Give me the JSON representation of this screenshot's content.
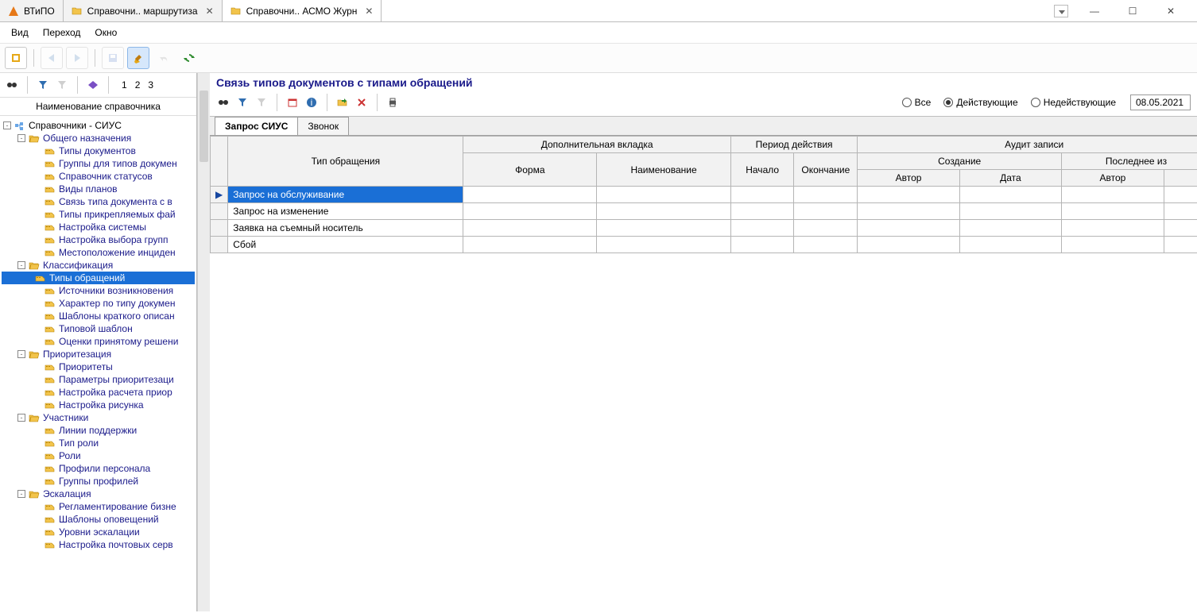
{
  "tabs": [
    {
      "label": "ВТиПО",
      "type": "triangle"
    },
    {
      "label": "Справочни.. маршрутиза",
      "type": "folder",
      "closable": true
    },
    {
      "label": "Справочни.. АСМО Журн",
      "type": "folder",
      "closable": true,
      "active": true
    }
  ],
  "menu": {
    "view": "Вид",
    "nav": "Переход",
    "window": "Окно"
  },
  "pager": {
    "one": "1",
    "two": "2",
    "three": "3"
  },
  "tree_header": "Наименование справочника",
  "tree": [
    {
      "lvl": 0,
      "t": "root",
      "toggle": "-",
      "label": "Справочники - СИУС",
      "black": true
    },
    {
      "lvl": 1,
      "t": "folder",
      "toggle": "-",
      "label": "Общего назначения"
    },
    {
      "lvl": 2,
      "t": "leaf",
      "label": "Типы документов"
    },
    {
      "lvl": 2,
      "t": "leaf",
      "label": "Группы для типов докумен"
    },
    {
      "lvl": 2,
      "t": "leaf",
      "label": "Справочник статусов"
    },
    {
      "lvl": 2,
      "t": "leaf",
      "label": "Виды планов"
    },
    {
      "lvl": 2,
      "t": "leaf",
      "label": "Связь типа документа с в"
    },
    {
      "lvl": 2,
      "t": "leaf",
      "label": "Типы прикрепляемых фай"
    },
    {
      "lvl": 2,
      "t": "leaf",
      "label": "Настройка системы"
    },
    {
      "lvl": 2,
      "t": "leaf",
      "label": "Настройка  выбора групп"
    },
    {
      "lvl": 2,
      "t": "leaf",
      "label": "Местоположение инциден"
    },
    {
      "lvl": 1,
      "t": "folder",
      "toggle": "-",
      "label": "Классификация"
    },
    {
      "lvl": 2,
      "t": "leaf",
      "label": "Типы обращений",
      "selected": true
    },
    {
      "lvl": 2,
      "t": "leaf",
      "label": "Источники возникновения"
    },
    {
      "lvl": 2,
      "t": "leaf",
      "label": "Характер по типу докумен"
    },
    {
      "lvl": 2,
      "t": "leaf",
      "label": "Шаблоны краткого описан"
    },
    {
      "lvl": 2,
      "t": "leaf",
      "label": "Типовой шаблон"
    },
    {
      "lvl": 2,
      "t": "leaf",
      "label": "Оценки принятому решени"
    },
    {
      "lvl": 1,
      "t": "folder",
      "toggle": "-",
      "label": "Приоритезация"
    },
    {
      "lvl": 2,
      "t": "leaf",
      "label": "Приоритеты"
    },
    {
      "lvl": 2,
      "t": "leaf",
      "label": "Параметры приоритезаци"
    },
    {
      "lvl": 2,
      "t": "leaf",
      "label": "Настройка расчета приор"
    },
    {
      "lvl": 2,
      "t": "leaf",
      "label": "Настройка рисунка"
    },
    {
      "lvl": 1,
      "t": "folder",
      "toggle": "-",
      "label": "Участники"
    },
    {
      "lvl": 2,
      "t": "leaf",
      "label": "Линии поддержки"
    },
    {
      "lvl": 2,
      "t": "leaf",
      "label": "Тип роли"
    },
    {
      "lvl": 2,
      "t": "leaf",
      "label": "Роли"
    },
    {
      "lvl": 2,
      "t": "leaf",
      "label": "Профили персонала"
    },
    {
      "lvl": 2,
      "t": "leaf",
      "label": "Группы профилей"
    },
    {
      "lvl": 1,
      "t": "folder",
      "toggle": "-",
      "label": "Эскалация"
    },
    {
      "lvl": 2,
      "t": "leaf",
      "label": "Регламентирование бизне"
    },
    {
      "lvl": 2,
      "t": "leaf",
      "label": "Шаблоны оповещений"
    },
    {
      "lvl": 2,
      "t": "leaf",
      "label": "Уровни эскалации"
    },
    {
      "lvl": 2,
      "t": "leaf",
      "label": "Настройка почтовых серв"
    }
  ],
  "page_title": "Связь типов документов с типами обращений",
  "filter": {
    "all": "Все",
    "active": "Действующие",
    "inactive": "Недействующие",
    "selected": "active",
    "date": "08.05.2021"
  },
  "subtabs": [
    {
      "label": "Запрос СИУС",
      "active": true
    },
    {
      "label": "Звонок"
    }
  ],
  "grid": {
    "headers": {
      "type": "Тип обращения",
      "additional": "Дополнительная вкладка",
      "form": "Форма",
      "name": "Наименование",
      "period": "Период действия",
      "start": "Начало",
      "end": "Окончание",
      "audit": "Аудит записи",
      "create": "Создание",
      "lastmod": "Последнее из",
      "author": "Автор",
      "date": "Дата",
      "author2": "Автор"
    },
    "rows": [
      {
        "cursor": "▶",
        "type": "Запрос на обслуживание",
        "selected": true
      },
      {
        "type": "Запрос на изменение"
      },
      {
        "type": "Заявка на съемный носитель"
      },
      {
        "type": "Сбой"
      }
    ]
  }
}
